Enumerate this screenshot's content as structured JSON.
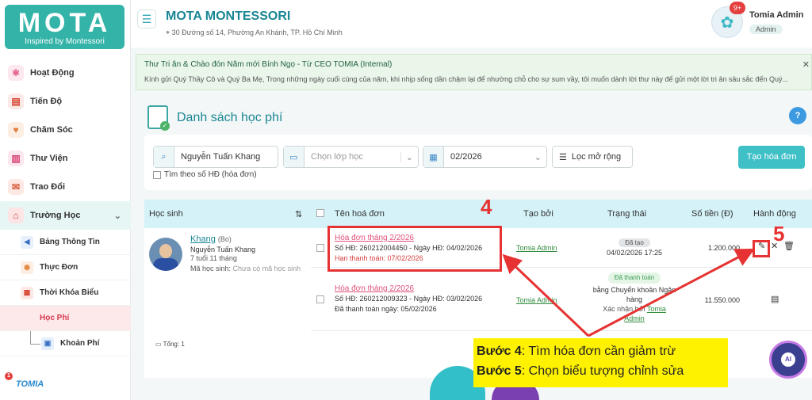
{
  "logo": {
    "title": "MOTA",
    "tagline": "Inspired by Montessori"
  },
  "nav": {
    "items": [
      {
        "label": "Hoạt Động",
        "icon": "atom-icon"
      },
      {
        "label": "Tiến Độ",
        "icon": "book-icon"
      },
      {
        "label": "Chăm Sóc",
        "icon": "care-icon"
      },
      {
        "label": "Thư Viện",
        "icon": "library-icon"
      },
      {
        "label": "Trao Đổi",
        "icon": "chat-icon"
      }
    ],
    "group_label": "Trường Học",
    "sub_items": [
      {
        "label": "Bảng Thông Tin"
      },
      {
        "label": "Thực Đơn"
      },
      {
        "label": "Thời Khóa Biểu"
      },
      {
        "label": "Học Phí"
      },
      {
        "label": "Khoản Phí"
      }
    ],
    "brand": "TOMIA",
    "brand_badge": "1"
  },
  "header": {
    "school": "MOTA MONTESSORI",
    "address": "30 Đường số 14, Phường An Khánh, TP. Hồ Chí Minh",
    "badge": "9+",
    "user_name": "Tomia Admin",
    "user_role": "Admin"
  },
  "notice": {
    "title": "Thư Tri ân & Chào đón Năm mới Bính Ngọ - Từ CEO TOMIA (Internal)",
    "body": "Kính gửi Quý Thầy Cô và Quý Ba Mẹ,   Trong những ngày cuối cùng của năm, khi nhịp sống dần chậm lại để nhường chỗ cho sự sum vầy, tôi muốn dành lời thư này để gửi một lời tri ân sâu sắc đến Quý..."
  },
  "page": {
    "title": "Danh sách học phí"
  },
  "filters": {
    "student": "Nguyễn Tuấn Khang",
    "class_placeholder": "Chọn lớp học",
    "month": "02/2026",
    "expand_label": "Lọc mở rộng",
    "search_by_invoice": "Tìm theo số HĐ (hóa đơn)",
    "create_label": "Tạo hóa đơn"
  },
  "table": {
    "headers": [
      "Học sinh",
      "Tên hoá đơn",
      "Tạo bởi",
      "Trạng thái",
      "Số tiền (Đ)",
      "Hành động"
    ],
    "student": {
      "name": "Khang",
      "nick": "(Bo)",
      "full": "Nguyễn Tuấn Khang",
      "age": "7 tuổi 11 tháng",
      "code_label": "Mã học sinh:",
      "code_value": "Chưa có mã học sinh"
    },
    "rows": [
      {
        "invoice": "Hóa đơn tháng 2/2026",
        "number": "Số HĐ: 260212004450 - Ngày HĐ: 04/02/2026",
        "due": "Hạn thanh toán: 07/02/2026",
        "creator": "Tomia Admin",
        "status": "Đã tạo",
        "status_date": "04/02/2026 17:25",
        "amount": "1.200.000"
      },
      {
        "invoice": "Hóa đơn tháng 2/2026",
        "number": "Số HĐ: 260212009323 - Ngày HĐ: 03/02/2026",
        "due": "Đã thanh toán ngày: 05/02/2026",
        "creator": "Tomia Admin",
        "status": "Đã thanh toán",
        "method": "bằng Chuyển khoản Ngân hàng",
        "confirm_prefix": "Xác nhận bởi",
        "confirm_by_1": "Tomia",
        "confirm_by_2": "Admin",
        "amount": "11.550.000"
      }
    ],
    "total": "Tổng: 1"
  },
  "annotations": {
    "step4_num": "4",
    "step5_num": "5",
    "step4_label": "Bước 4",
    "step4_text": ": Tìm hóa đơn cần giảm trừ",
    "step5_label": "Bước 5",
    "step5_text": ": Chọn biểu tượng chỉnh sửa"
  },
  "colors": {
    "brand": "#34b3a8",
    "accent": "#1a8694",
    "annotation": "#e63232",
    "callout": "#fff200"
  }
}
